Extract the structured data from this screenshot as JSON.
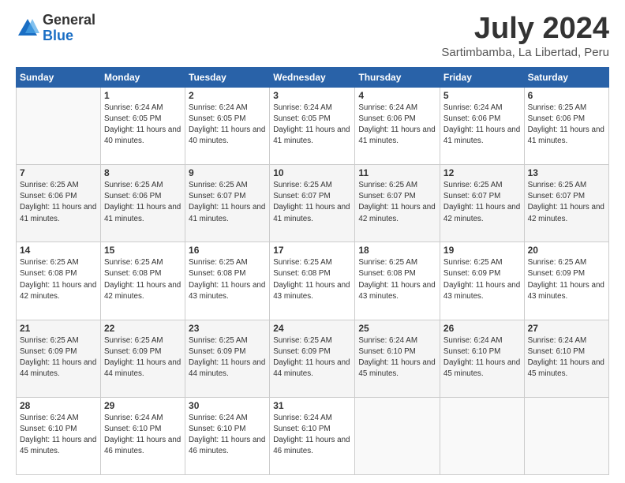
{
  "logo": {
    "general": "General",
    "blue": "Blue"
  },
  "title": "July 2024",
  "location": "Sartimbamba, La Libertad, Peru",
  "days_header": [
    "Sunday",
    "Monday",
    "Tuesday",
    "Wednesday",
    "Thursday",
    "Friday",
    "Saturday"
  ],
  "weeks": [
    [
      {
        "day": "",
        "sunrise": "",
        "sunset": "",
        "daylight": ""
      },
      {
        "day": "1",
        "sunrise": "Sunrise: 6:24 AM",
        "sunset": "Sunset: 6:05 PM",
        "daylight": "Daylight: 11 hours and 40 minutes."
      },
      {
        "day": "2",
        "sunrise": "Sunrise: 6:24 AM",
        "sunset": "Sunset: 6:05 PM",
        "daylight": "Daylight: 11 hours and 40 minutes."
      },
      {
        "day": "3",
        "sunrise": "Sunrise: 6:24 AM",
        "sunset": "Sunset: 6:05 PM",
        "daylight": "Daylight: 11 hours and 41 minutes."
      },
      {
        "day": "4",
        "sunrise": "Sunrise: 6:24 AM",
        "sunset": "Sunset: 6:06 PM",
        "daylight": "Daylight: 11 hours and 41 minutes."
      },
      {
        "day": "5",
        "sunrise": "Sunrise: 6:24 AM",
        "sunset": "Sunset: 6:06 PM",
        "daylight": "Daylight: 11 hours and 41 minutes."
      },
      {
        "day": "6",
        "sunrise": "Sunrise: 6:25 AM",
        "sunset": "Sunset: 6:06 PM",
        "daylight": "Daylight: 11 hours and 41 minutes."
      }
    ],
    [
      {
        "day": "7",
        "sunrise": "Sunrise: 6:25 AM",
        "sunset": "Sunset: 6:06 PM",
        "daylight": "Daylight: 11 hours and 41 minutes."
      },
      {
        "day": "8",
        "sunrise": "Sunrise: 6:25 AM",
        "sunset": "Sunset: 6:06 PM",
        "daylight": "Daylight: 11 hours and 41 minutes."
      },
      {
        "day": "9",
        "sunrise": "Sunrise: 6:25 AM",
        "sunset": "Sunset: 6:07 PM",
        "daylight": "Daylight: 11 hours and 41 minutes."
      },
      {
        "day": "10",
        "sunrise": "Sunrise: 6:25 AM",
        "sunset": "Sunset: 6:07 PM",
        "daylight": "Daylight: 11 hours and 41 minutes."
      },
      {
        "day": "11",
        "sunrise": "Sunrise: 6:25 AM",
        "sunset": "Sunset: 6:07 PM",
        "daylight": "Daylight: 11 hours and 42 minutes."
      },
      {
        "day": "12",
        "sunrise": "Sunrise: 6:25 AM",
        "sunset": "Sunset: 6:07 PM",
        "daylight": "Daylight: 11 hours and 42 minutes."
      },
      {
        "day": "13",
        "sunrise": "Sunrise: 6:25 AM",
        "sunset": "Sunset: 6:07 PM",
        "daylight": "Daylight: 11 hours and 42 minutes."
      }
    ],
    [
      {
        "day": "14",
        "sunrise": "Sunrise: 6:25 AM",
        "sunset": "Sunset: 6:08 PM",
        "daylight": "Daylight: 11 hours and 42 minutes."
      },
      {
        "day": "15",
        "sunrise": "Sunrise: 6:25 AM",
        "sunset": "Sunset: 6:08 PM",
        "daylight": "Daylight: 11 hours and 42 minutes."
      },
      {
        "day": "16",
        "sunrise": "Sunrise: 6:25 AM",
        "sunset": "Sunset: 6:08 PM",
        "daylight": "Daylight: 11 hours and 43 minutes."
      },
      {
        "day": "17",
        "sunrise": "Sunrise: 6:25 AM",
        "sunset": "Sunset: 6:08 PM",
        "daylight": "Daylight: 11 hours and 43 minutes."
      },
      {
        "day": "18",
        "sunrise": "Sunrise: 6:25 AM",
        "sunset": "Sunset: 6:08 PM",
        "daylight": "Daylight: 11 hours and 43 minutes."
      },
      {
        "day": "19",
        "sunrise": "Sunrise: 6:25 AM",
        "sunset": "Sunset: 6:09 PM",
        "daylight": "Daylight: 11 hours and 43 minutes."
      },
      {
        "day": "20",
        "sunrise": "Sunrise: 6:25 AM",
        "sunset": "Sunset: 6:09 PM",
        "daylight": "Daylight: 11 hours and 43 minutes."
      }
    ],
    [
      {
        "day": "21",
        "sunrise": "Sunrise: 6:25 AM",
        "sunset": "Sunset: 6:09 PM",
        "daylight": "Daylight: 11 hours and 44 minutes."
      },
      {
        "day": "22",
        "sunrise": "Sunrise: 6:25 AM",
        "sunset": "Sunset: 6:09 PM",
        "daylight": "Daylight: 11 hours and 44 minutes."
      },
      {
        "day": "23",
        "sunrise": "Sunrise: 6:25 AM",
        "sunset": "Sunset: 6:09 PM",
        "daylight": "Daylight: 11 hours and 44 minutes."
      },
      {
        "day": "24",
        "sunrise": "Sunrise: 6:25 AM",
        "sunset": "Sunset: 6:09 PM",
        "daylight": "Daylight: 11 hours and 44 minutes."
      },
      {
        "day": "25",
        "sunrise": "Sunrise: 6:24 AM",
        "sunset": "Sunset: 6:10 PM",
        "daylight": "Daylight: 11 hours and 45 minutes."
      },
      {
        "day": "26",
        "sunrise": "Sunrise: 6:24 AM",
        "sunset": "Sunset: 6:10 PM",
        "daylight": "Daylight: 11 hours and 45 minutes."
      },
      {
        "day": "27",
        "sunrise": "Sunrise: 6:24 AM",
        "sunset": "Sunset: 6:10 PM",
        "daylight": "Daylight: 11 hours and 45 minutes."
      }
    ],
    [
      {
        "day": "28",
        "sunrise": "Sunrise: 6:24 AM",
        "sunset": "Sunset: 6:10 PM",
        "daylight": "Daylight: 11 hours and 45 minutes."
      },
      {
        "day": "29",
        "sunrise": "Sunrise: 6:24 AM",
        "sunset": "Sunset: 6:10 PM",
        "daylight": "Daylight: 11 hours and 46 minutes."
      },
      {
        "day": "30",
        "sunrise": "Sunrise: 6:24 AM",
        "sunset": "Sunset: 6:10 PM",
        "daylight": "Daylight: 11 hours and 46 minutes."
      },
      {
        "day": "31",
        "sunrise": "Sunrise: 6:24 AM",
        "sunset": "Sunset: 6:10 PM",
        "daylight": "Daylight: 11 hours and 46 minutes."
      },
      {
        "day": "",
        "sunrise": "",
        "sunset": "",
        "daylight": ""
      },
      {
        "day": "",
        "sunrise": "",
        "sunset": "",
        "daylight": ""
      },
      {
        "day": "",
        "sunrise": "",
        "sunset": "",
        "daylight": ""
      }
    ]
  ]
}
